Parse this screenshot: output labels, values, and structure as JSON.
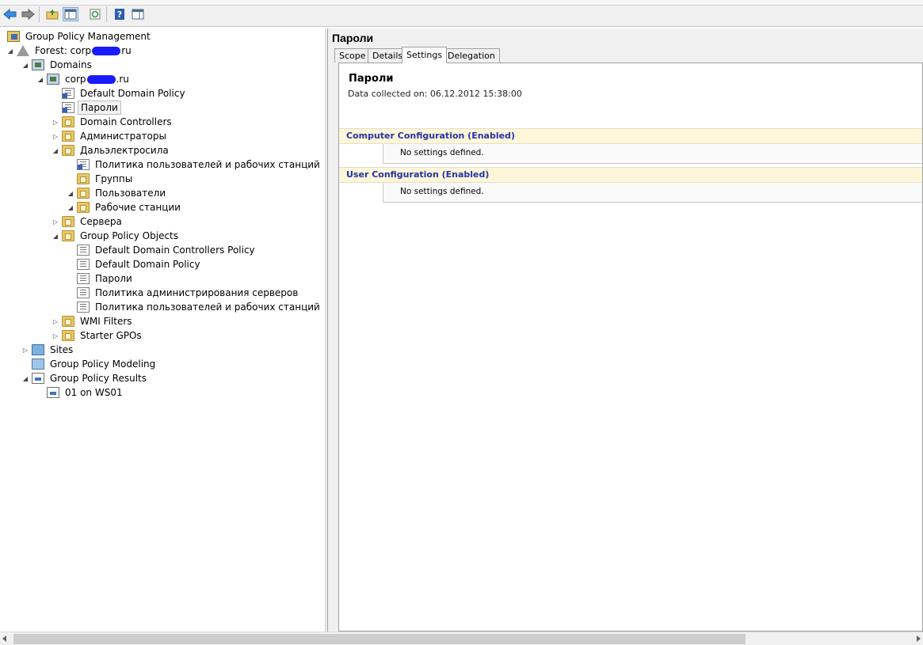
{
  "toolbar": {
    "buttons": [
      "back-arrow-icon",
      "forward-arrow-icon",
      "up-folder-icon",
      "show-hide-tree-icon",
      "refresh-icon",
      "help-icon",
      "action-pane-icon"
    ]
  },
  "tree": {
    "root": "Group Policy Management",
    "forest_prefix": "Forest: corp",
    "forest_suffix": "ru",
    "domains": "Domains",
    "domain_prefix": "corp",
    "domain_suffix": ".ru",
    "items": [
      "Default Domain Policy",
      "Пароли",
      "Domain Controllers",
      "Администраторы",
      "Дальэлектросила",
      "Политика пользователей и рабочих станций",
      "Группы",
      "Пользователи",
      "Рабочие станции",
      "Сервера",
      "Group Policy Objects",
      "Default Domain Controllers Policy",
      "Default Domain Policy",
      "Пароли",
      "Политика администрирования серверов",
      "Политика пользователей и рабочих станций",
      "WMI Filters",
      "Starter GPOs",
      "Sites",
      "Group Policy Modeling",
      "Group Policy Results",
      "01 on WS01"
    ]
  },
  "right": {
    "title": "Пароли",
    "tabs": [
      "Scope",
      "Details",
      "Settings",
      "Delegation"
    ],
    "active_tab": "Settings",
    "report": {
      "title": "Пароли",
      "date": "Data collected on: 06.12.2012 15:38:00",
      "sections": [
        {
          "header": "Computer Configuration (Enabled)",
          "body": "No settings defined."
        },
        {
          "header": "User Configuration (Enabled)",
          "body": "No settings defined."
        }
      ]
    }
  }
}
